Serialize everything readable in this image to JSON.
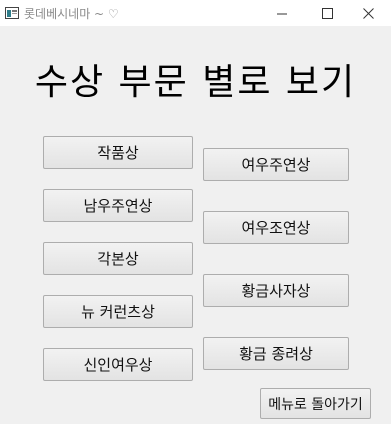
{
  "window": {
    "title": "롯데베시네마 ~ ♡",
    "minimize_icon": "minimize-icon",
    "maximize_icon": "maximize-icon",
    "close_icon": "close-icon"
  },
  "main": {
    "heading": "수상 부문 별로 보기",
    "left_buttons": [
      "작품상",
      "남우주연상",
      "각본상",
      "뉴 커런츠상",
      "신인여우상"
    ],
    "right_buttons": [
      "여우주연상",
      "여우조연상",
      "황금사자상",
      "황금 종려상"
    ],
    "back_button": "메뉴로 돌아가기"
  }
}
